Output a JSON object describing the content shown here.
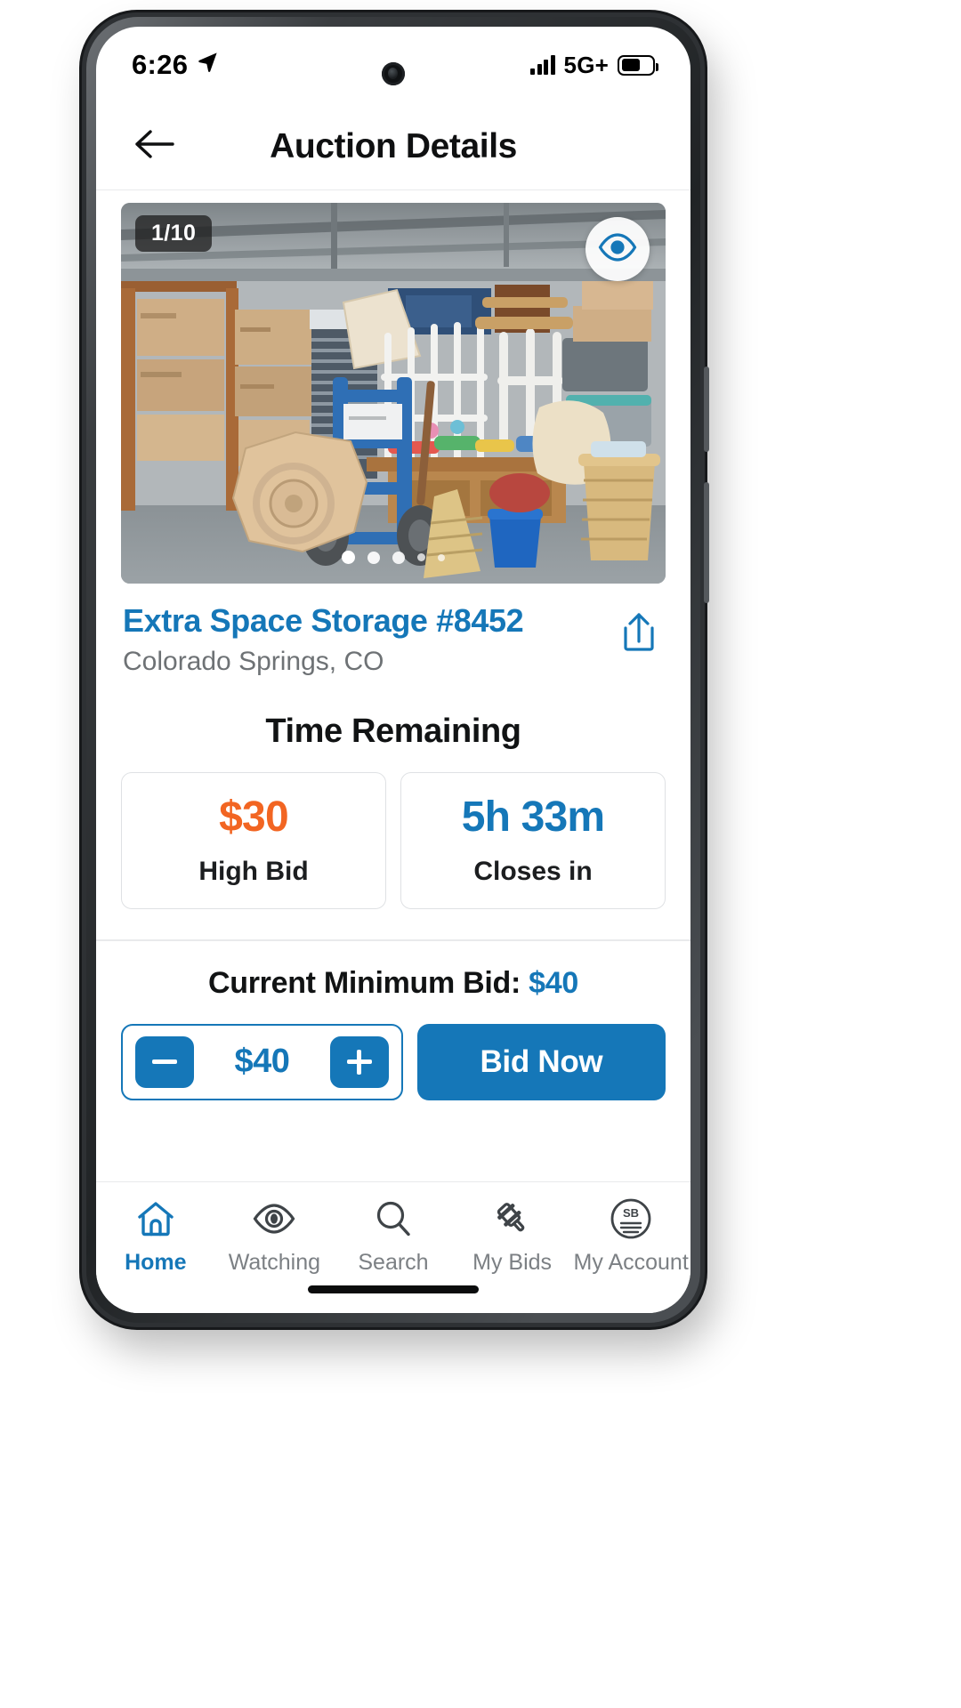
{
  "status_bar": {
    "time": "6:26",
    "location_icon": "location-arrow-icon",
    "signal_icon": "signal-bars-icon",
    "network": "5G+",
    "battery_icon": "battery-icon"
  },
  "header": {
    "back_icon": "arrow-left-icon",
    "title": "Auction Details"
  },
  "gallery": {
    "counter": "1/10",
    "watch_icon": "eye-icon",
    "dot_count": 5,
    "active_dot": 1,
    "photo_alt": "storage-unit-photo"
  },
  "listing": {
    "title": "Extra Space Storage #8452",
    "location": "Colorado Springs, CO",
    "share_icon": "share-icon"
  },
  "time_remaining": {
    "heading": "Time Remaining",
    "cards": [
      {
        "value": "$30",
        "label": "High Bid",
        "color": "#f26522"
      },
      {
        "value": "5h 33m",
        "label": "Closes in",
        "color": "#1577b8"
      }
    ]
  },
  "bid": {
    "minimum_label": "Current Minimum Bid: ",
    "minimum_value": "$40",
    "decrement_icon": "minus-icon",
    "amount": "$40",
    "increment_icon": "plus-icon",
    "submit_label": "Bid Now"
  },
  "bottom_nav": {
    "items": [
      {
        "label": "Home",
        "icon": "home-icon",
        "active": true
      },
      {
        "label": "Watching",
        "icon": "eye-icon",
        "active": false
      },
      {
        "label": "Search",
        "icon": "search-icon",
        "active": false
      },
      {
        "label": "My Bids",
        "icon": "gavel-icon",
        "active": false
      },
      {
        "label": "My Account",
        "icon": "account-sb-icon",
        "active": false
      }
    ],
    "account_initials": "SB"
  },
  "colors": {
    "brand_blue": "#1577b8",
    "accent_orange": "#f26522",
    "text_dark": "#111314",
    "text_muted": "#7c8084"
  }
}
